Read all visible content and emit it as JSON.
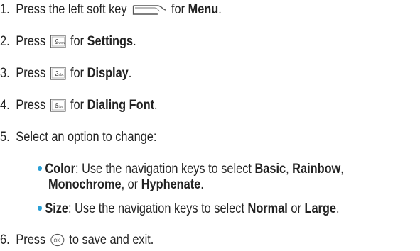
{
  "bullet_color": "#2a9fd6",
  "steps": [
    {
      "num": "1.",
      "pre": "Press the left soft key",
      "key_icon": "left-soft-key-icon",
      "mid": "for",
      "bold": "Menu",
      "post": "."
    },
    {
      "num": "2.",
      "pre": "Press",
      "key_icon": "key-9-wxyz-icon",
      "key_label": "9",
      "key_sub": "wxyz",
      "mid": "for",
      "bold": "Settings",
      "post": "."
    },
    {
      "num": "3.",
      "pre": "Press",
      "key_icon": "key-2-abc-icon",
      "key_label": "2",
      "key_sub": "abc",
      "mid": "for",
      "bold": "Display",
      "post": "."
    },
    {
      "num": "4.",
      "pre": "Press",
      "key_icon": "key-8-tuv-icon",
      "key_label": "8",
      "key_sub": "tuv",
      "mid": "for",
      "bold": "Dialing Font",
      "post": "."
    },
    {
      "num": "5.",
      "text": "Select an option to change:"
    },
    {
      "num": "6.",
      "pre": "Press",
      "key_icon": "ok-key-icon",
      "key_label": "OK",
      "post": "to save and exit."
    }
  ],
  "options": [
    {
      "name": "Color",
      "text": ": Use the navigation keys to select",
      "choices": [
        "Basic",
        "Rainbow",
        "Monochrome",
        "Hyphenate"
      ],
      "sep1": ",",
      "sep2": ",",
      "sep3": ", or",
      "end": "."
    },
    {
      "name": "Size",
      "text": ": Use the navigation keys to select",
      "choices": [
        "Normal",
        "Large"
      ],
      "sep1": "or",
      "end": "."
    }
  ]
}
